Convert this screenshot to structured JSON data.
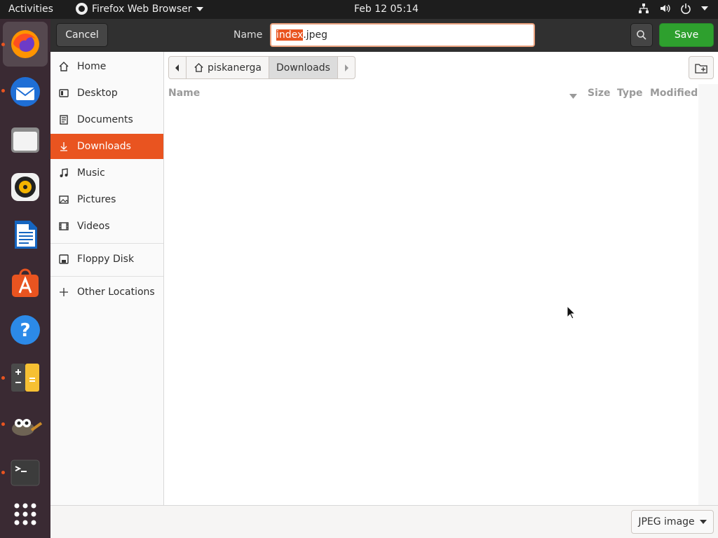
{
  "topbar": {
    "activities": "Activities",
    "app_name": "Firefox Web Browser",
    "clock": "Feb 12  05:14"
  },
  "dock": {
    "items": [
      {
        "name": "firefox",
        "running": true
      },
      {
        "name": "thunderbird",
        "running": true
      },
      {
        "name": "files",
        "running": false
      },
      {
        "name": "rhythmbox",
        "running": false
      },
      {
        "name": "libreoffice-writer",
        "running": false
      },
      {
        "name": "ubuntu-software",
        "running": false
      },
      {
        "name": "help",
        "running": false
      },
      {
        "name": "calculator",
        "running": true
      },
      {
        "name": "gimp",
        "running": true
      },
      {
        "name": "terminal",
        "running": true
      },
      {
        "name": "show-applications",
        "running": false
      }
    ]
  },
  "dialog": {
    "cancel_label": "Cancel",
    "name_label": "Name",
    "filename": {
      "selected": "index",
      "rest": ".jpeg"
    },
    "save_label": "Save"
  },
  "sidebar": {
    "items": [
      {
        "label": "Home",
        "icon": "home-icon"
      },
      {
        "label": "Desktop",
        "icon": "desktop-icon"
      },
      {
        "label": "Documents",
        "icon": "documents-icon"
      },
      {
        "label": "Downloads",
        "icon": "downloads-icon",
        "selected": true
      },
      {
        "label": "Music",
        "icon": "music-icon"
      },
      {
        "label": "Pictures",
        "icon": "pictures-icon"
      },
      {
        "label": "Videos",
        "icon": "videos-icon"
      }
    ],
    "devices": [
      {
        "label": "Floppy Disk",
        "icon": "floppy-icon"
      }
    ],
    "other": {
      "label": "Other Locations",
      "icon": "plus-icon"
    }
  },
  "pathbar": {
    "segments": [
      "piskanerga",
      "Downloads"
    ]
  },
  "filelist": {
    "columns": [
      "Name",
      "Size",
      "Type",
      "Modified"
    ],
    "rows": []
  },
  "footer": {
    "filter_label": "JPEG image"
  },
  "colors": {
    "accent": "#e95420",
    "save": "#2ea02e",
    "headerbar": "#303030",
    "dock": "#3a2a33"
  }
}
